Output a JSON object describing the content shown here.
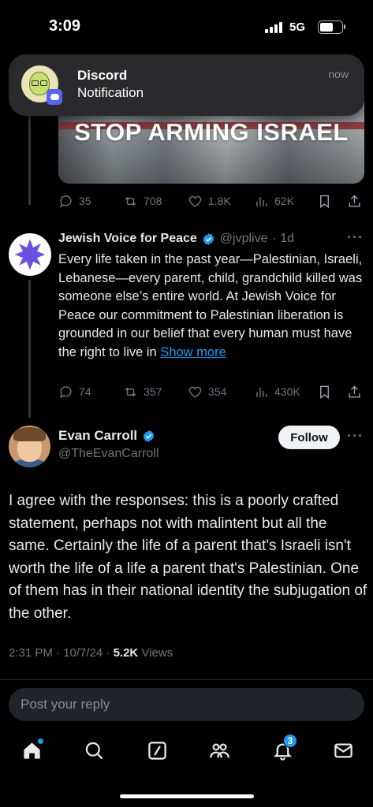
{
  "status_bar": {
    "time": "3:09",
    "network": "5G"
  },
  "notification": {
    "app": "Discord",
    "body": "Notification",
    "time": "now"
  },
  "tweet1": {
    "image_text": "STOP ARMING ISRAEL",
    "replies": "35",
    "reposts": "708",
    "likes": "1.8K",
    "views": "62K"
  },
  "tweet2": {
    "name": "Jewish Voice for Peace",
    "handle": "@jvplive",
    "time": "· 1d",
    "text": "Every life taken in the past year—Palestinian, Israeli, Lebanese—every parent, child, grandchild killed was someone else’s entire world. At Jewish Voice for Peace our commitment to Palestinian liberation is grounded in our belief that every human must have the right to live in ",
    "show_more": "Show more",
    "replies": "74",
    "reposts": "357",
    "likes": "354",
    "views": "430K"
  },
  "main_tweet": {
    "name": "Evan Carroll",
    "handle": "@TheEvanCarroll",
    "follow_label": "Follow",
    "text": "I agree with the responses: this is a poorly crafted statement, perhaps not with malintent but all the same. Certainly the life of a parent that's Israeli isn't worth the life of a life a parent that's Palestinian. One of them has in their national identity the subjugation of the other.",
    "timestamp": "2:31 PM · 10/7/24 · ",
    "views_count": "5.2K",
    "views_label": " Views"
  },
  "reply": {
    "placeholder": "Post your reply"
  },
  "nav": {
    "notification_count": "3"
  },
  "colors": {
    "accent": "#1d9bf0",
    "background": "#000000",
    "muted": "#71767b"
  }
}
